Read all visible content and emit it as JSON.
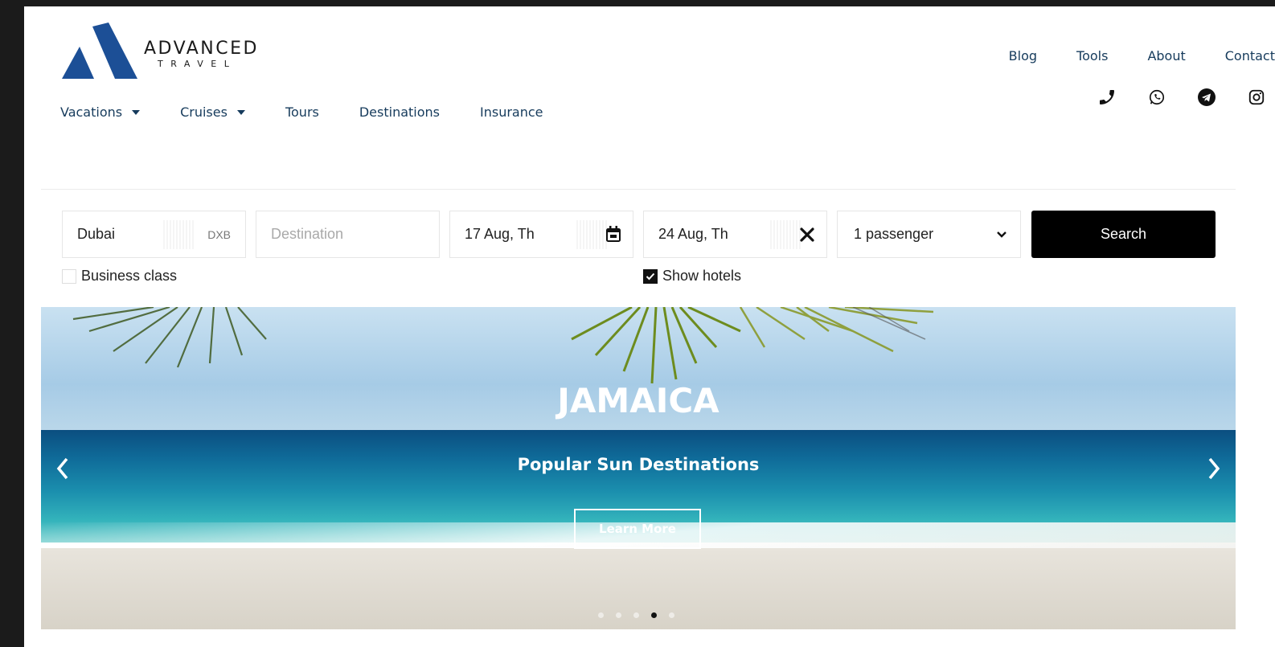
{
  "brand": {
    "name": "ADVANCED",
    "tagline": "TRAVEL",
    "color": "#1c4f96"
  },
  "top_nav": [
    "Blog",
    "Tools",
    "About",
    "Contact"
  ],
  "social_icons": [
    "phone-icon",
    "whatsapp-icon",
    "telegram-icon",
    "instagram-icon"
  ],
  "main_nav": [
    {
      "label": "Vacations",
      "dropdown": true
    },
    {
      "label": "Cruises",
      "dropdown": true
    },
    {
      "label": "Tours",
      "dropdown": false
    },
    {
      "label": "Destinations",
      "dropdown": false
    },
    {
      "label": "Insurance",
      "dropdown": false
    }
  ],
  "search": {
    "origin": {
      "value": "Dubai",
      "code": "DXB"
    },
    "destination": {
      "placeholder": "Destination"
    },
    "depart_date": "17 Aug, Th",
    "return_date": "24 Aug, Th",
    "passengers": "1 passenger",
    "search_label": "Search",
    "business_class": {
      "label": "Business class",
      "checked": false
    },
    "show_hotels": {
      "label": "Show hotels",
      "checked": true
    }
  },
  "hero": {
    "title": "JAMAICA",
    "subtitle": "Popular Sun Destinations",
    "cta": "Learn More",
    "slide_count": 5,
    "active_slide": 4
  }
}
